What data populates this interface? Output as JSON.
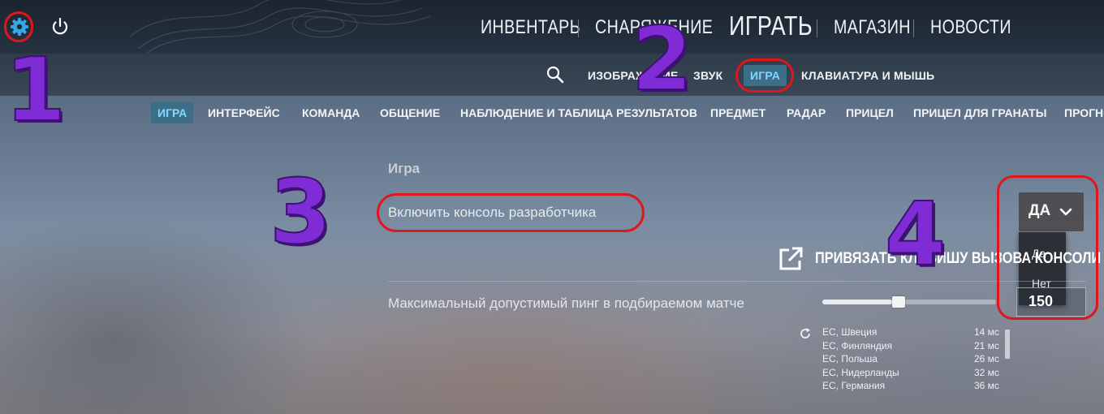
{
  "top_nav": {
    "items": [
      "ИНВЕНТАРЬ",
      "СНАРЯЖЕНИЕ",
      "ИГРАТЬ",
      "МАГАЗИН",
      "НОВОСТИ"
    ]
  },
  "settings_tabs": {
    "items": [
      "ИЗОБРАЖЕНИЕ",
      "ЗВУК",
      "ИГРА",
      "КЛАВИАТУРА И МЫШЬ"
    ],
    "active": "ИГРА"
  },
  "categories": {
    "items": [
      "ИГРА",
      "ИНТЕРФЕЙС",
      "КОМАНДА",
      "ОБЩЕНИЕ",
      "НАБЛЮДЕНИЕ И ТАБЛИЦА РЕЗУЛЬТАТОВ",
      "ПРЕДМЕТ",
      "РАДАР",
      "ПРИЦЕЛ",
      "ПРИЦЕЛ ДЛЯ ГРАНАТЫ",
      "ПРОГНОЗ"
    ],
    "active": "ИГРА"
  },
  "section": {
    "title": "Игра"
  },
  "dev_console": {
    "label": "Включить консоль разработчика",
    "value": "ДА",
    "options": [
      "Да",
      "Нет"
    ]
  },
  "bind_key": {
    "label": "ПРИВЯЗАТЬ КЛАВИШУ ВЫЗОВА КОНСОЛИ"
  },
  "max_ping": {
    "label": "Максимальный допустимый пинг в подбираемом матче",
    "value": "150",
    "slider_fraction": 0.4
  },
  "servers": [
    {
      "name": "ЕС, Швеция",
      "ping": "14 мс"
    },
    {
      "name": "ЕС, Финляндия",
      "ping": "21 мс"
    },
    {
      "name": "ЕС, Польша",
      "ping": "26 мс"
    },
    {
      "name": "ЕС, Нидерланды",
      "ping": "32 мс"
    },
    {
      "name": "ЕС, Германия",
      "ping": "36 мс"
    }
  ],
  "annotations": {
    "step1": "1",
    "step2": "2",
    "step3": "3",
    "step4": "4"
  },
  "colors": {
    "accent": "#7fd6ff",
    "annotation_ring": "#e0161d",
    "annotation_number": "#7f2bd6"
  }
}
